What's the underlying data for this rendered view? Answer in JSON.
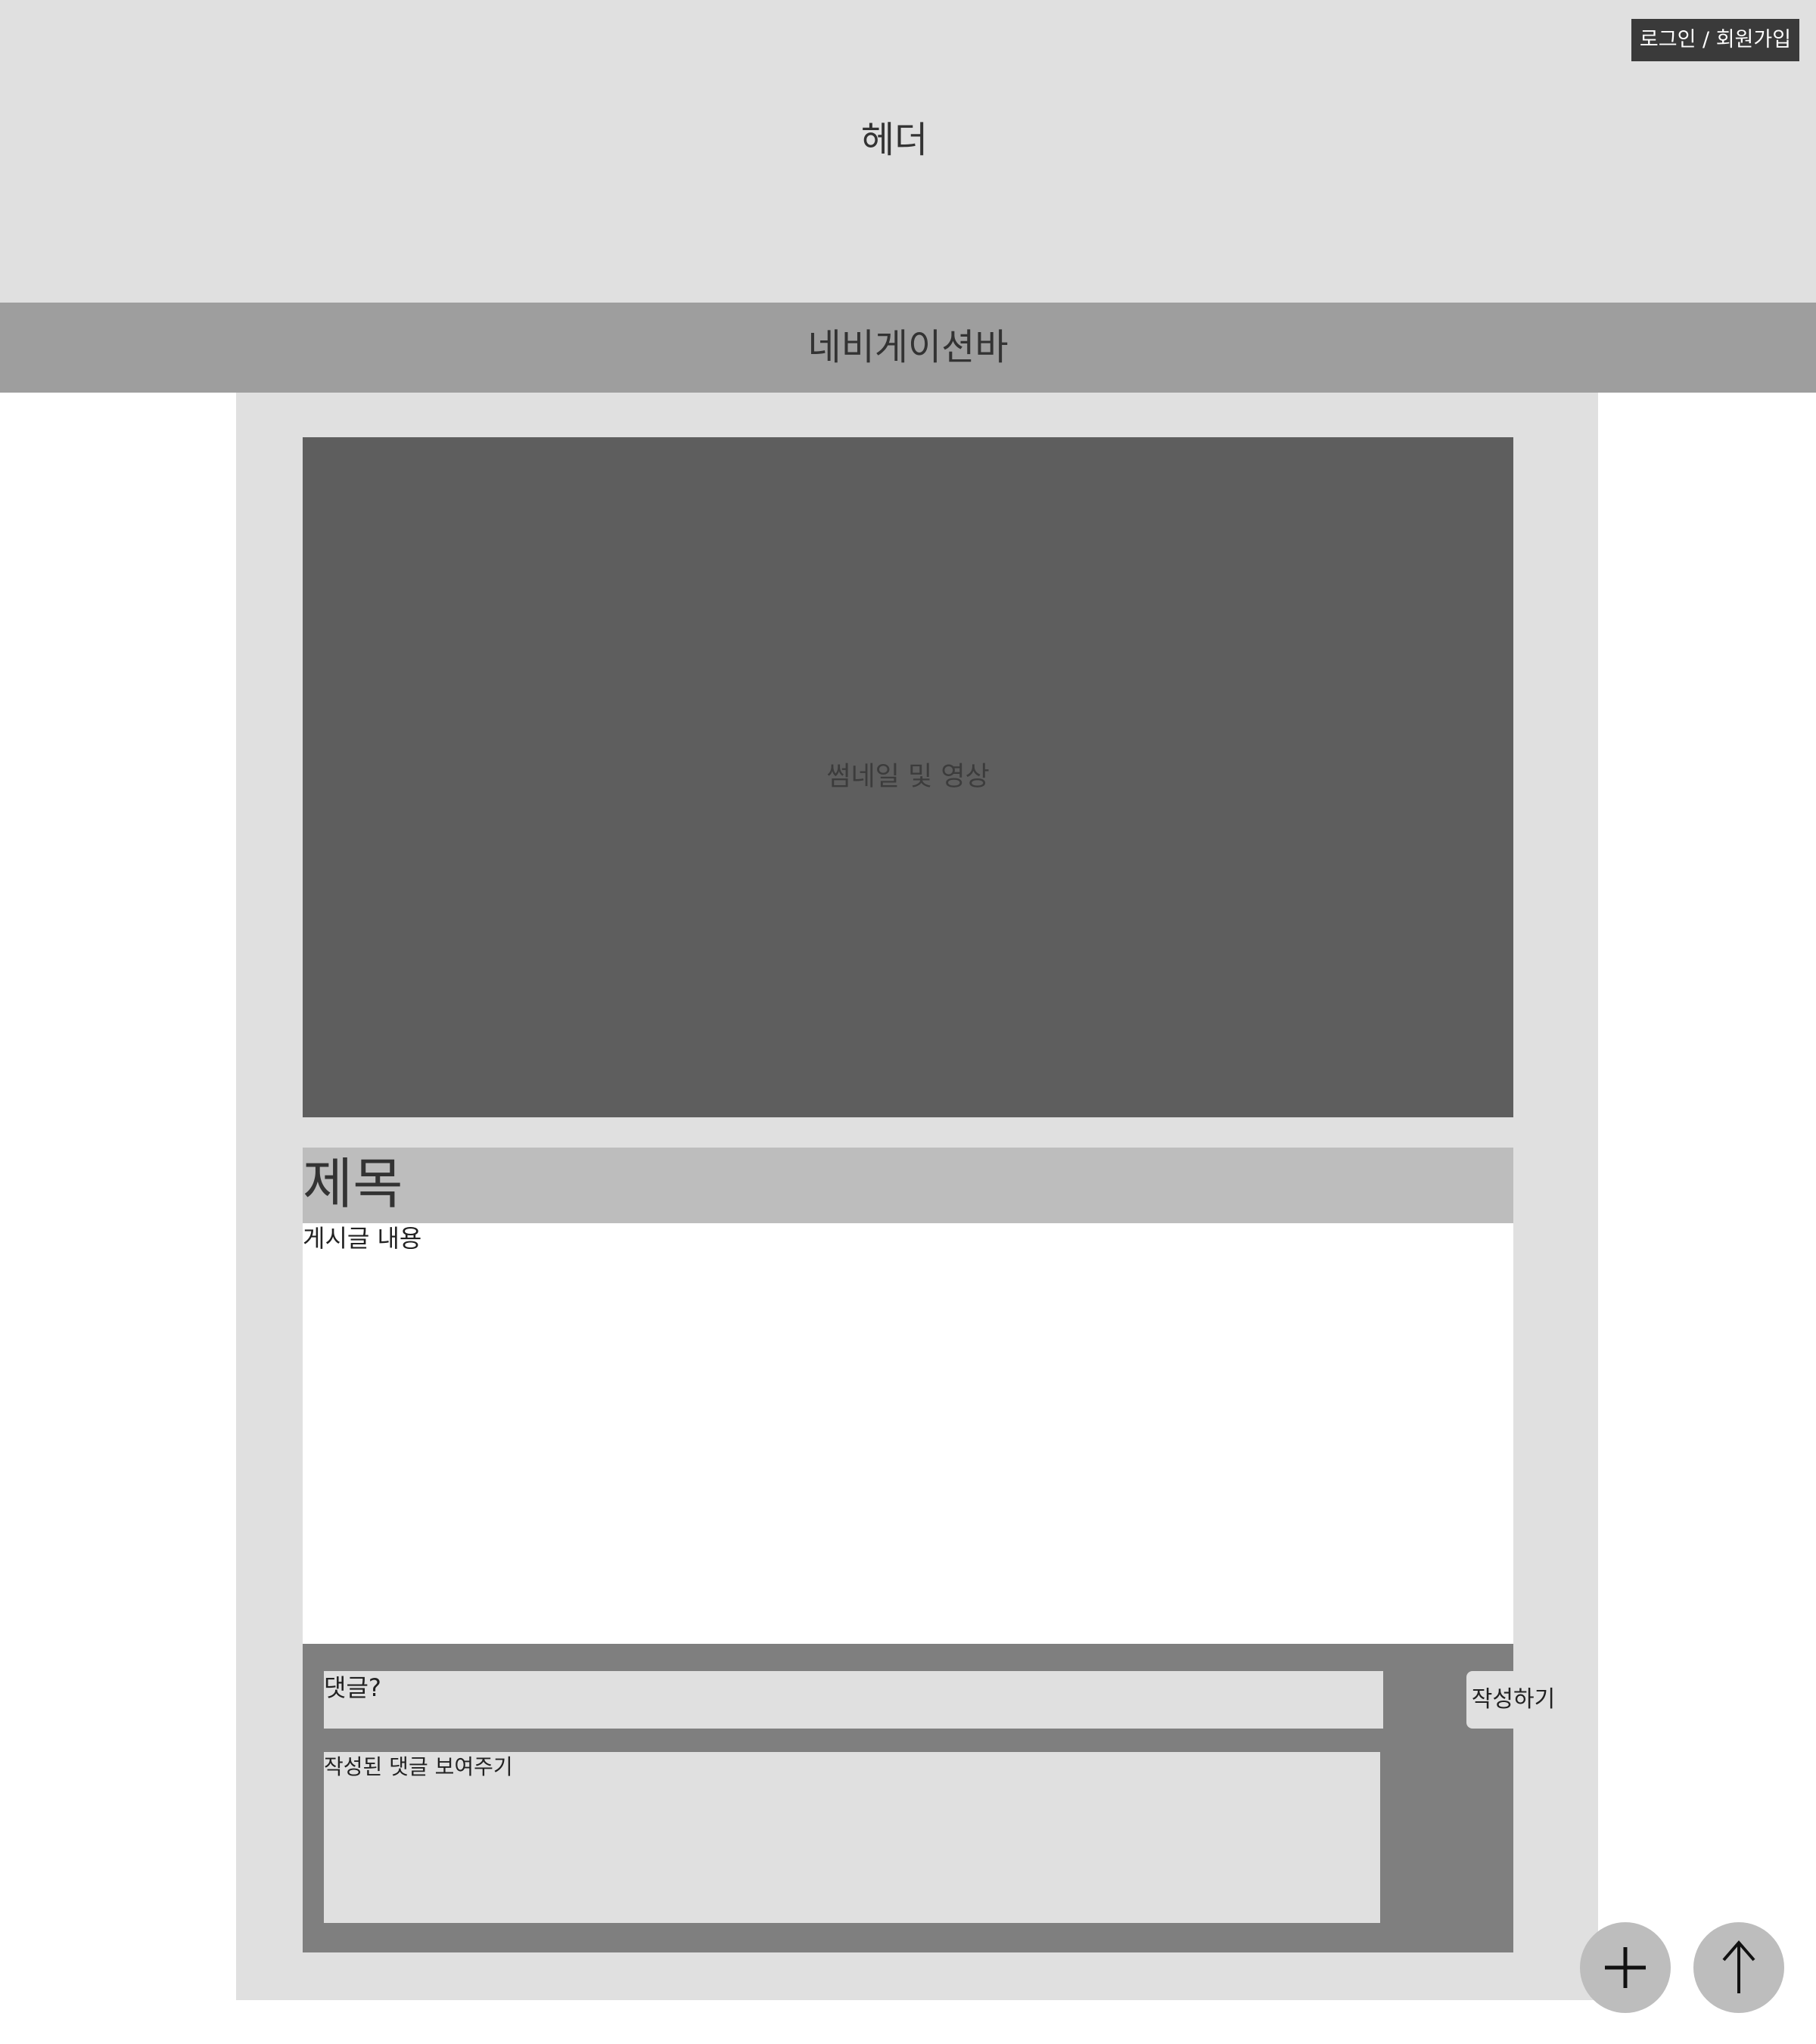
{
  "header": {
    "title": "헤더",
    "login_label": "로그인 / 회원가입"
  },
  "navbar": {
    "label": "네비게이션바"
  },
  "post": {
    "media_label": "썸네일 및 영상",
    "title": "제목",
    "content": "게시글 내용"
  },
  "comments": {
    "input_placeholder": "댓글?",
    "submit_label": "작성하기",
    "list_placeholder": "작성된 댓글 보여주기"
  },
  "floating_buttons": {
    "add_icon": "plus-icon",
    "top_icon": "arrow-up-icon"
  },
  "colors": {
    "header_bg": "#e0e0e0",
    "navbar_bg": "#9e9e9e",
    "media_bg": "#5e5e5e",
    "title_bg": "#bdbdbd",
    "comments_bg": "#7f7f7f",
    "login_bg": "#3a3a3a"
  }
}
